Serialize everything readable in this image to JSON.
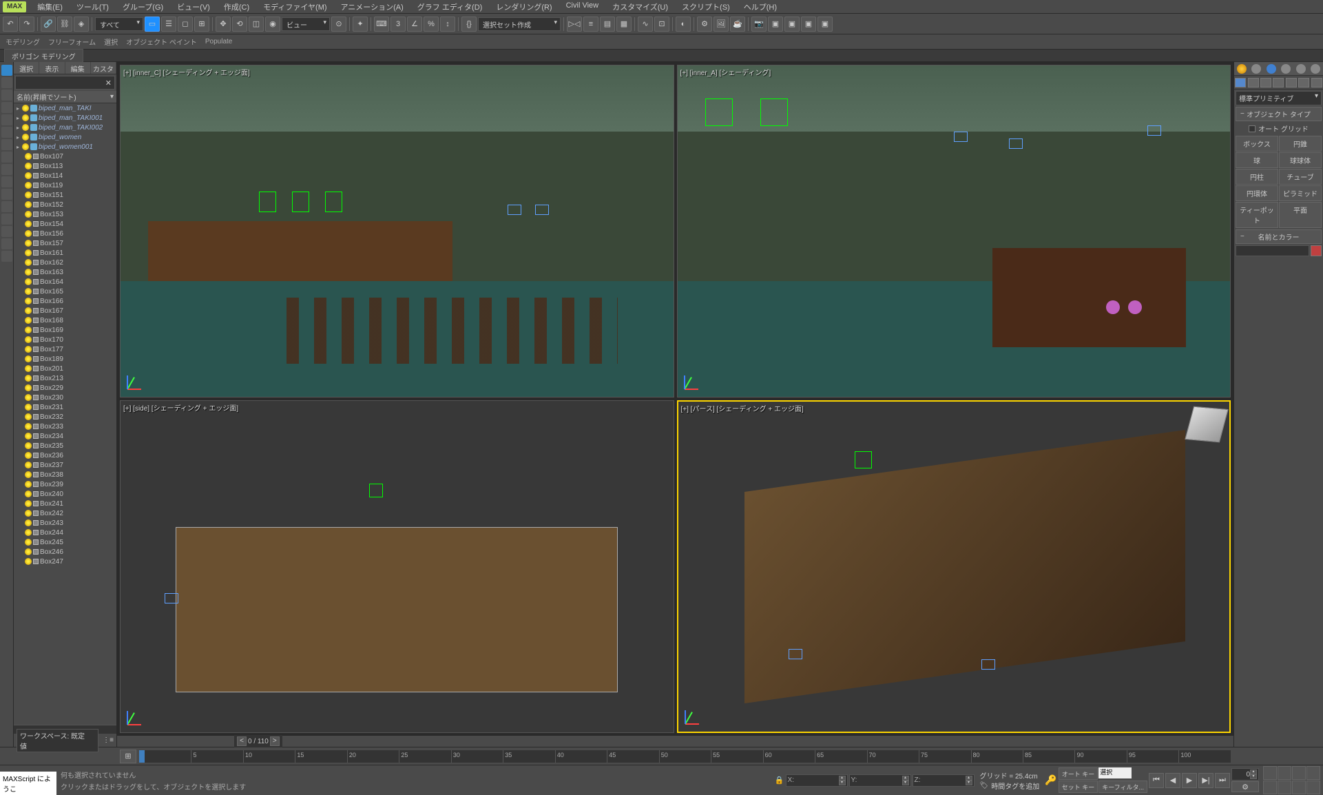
{
  "app": {
    "logo": "MAX"
  },
  "menu": {
    "items": [
      "編集(E)",
      "ツール(T)",
      "グループ(G)",
      "ビュー(V)",
      "作成(C)",
      "モディファイヤ(M)",
      "アニメーション(A)",
      "グラフ エディタ(D)",
      "レンダリング(R)",
      "Civil View",
      "カスタマイズ(U)",
      "スクリプト(S)",
      "ヘルプ(H)"
    ]
  },
  "toolbar1": {
    "filter_dropdown": "すべて",
    "view_dropdown": "ビュー",
    "selection_set_dropdown": "選択セット作成"
  },
  "secondBar": {
    "items": [
      "モデリング",
      "フリーフォーム",
      "選択",
      "オブジェクト ペイント",
      "Populate"
    ]
  },
  "ribbonTab": "ポリゴン モデリング",
  "scenePanel": {
    "tabs": [
      "選択",
      "表示",
      "編集",
      "カスタマイズ"
    ],
    "sortHeader": "名前(昇順でソート)",
    "items": [
      {
        "type": "biped",
        "collapse": "▸",
        "label": "biped_man_TAKI"
      },
      {
        "type": "biped",
        "collapse": "▸",
        "label": "biped_man_TAKI001"
      },
      {
        "type": "biped",
        "collapse": "▸",
        "label": "biped_man_TAKI002"
      },
      {
        "type": "biped",
        "collapse": "▸",
        "label": "biped_women"
      },
      {
        "type": "biped",
        "collapse": "▸",
        "label": "biped_women001"
      },
      {
        "type": "box",
        "label": "Box107"
      },
      {
        "type": "box",
        "label": "Box113"
      },
      {
        "type": "box",
        "label": "Box114"
      },
      {
        "type": "box",
        "label": "Box119"
      },
      {
        "type": "box",
        "label": "Box151"
      },
      {
        "type": "box",
        "label": "Box152"
      },
      {
        "type": "box",
        "label": "Box153"
      },
      {
        "type": "box",
        "label": "Box154"
      },
      {
        "type": "box",
        "label": "Box156"
      },
      {
        "type": "box",
        "label": "Box157"
      },
      {
        "type": "box",
        "label": "Box161"
      },
      {
        "type": "box",
        "label": "Box162"
      },
      {
        "type": "box",
        "label": "Box163"
      },
      {
        "type": "box",
        "label": "Box164"
      },
      {
        "type": "box",
        "label": "Box165"
      },
      {
        "type": "box",
        "label": "Box166"
      },
      {
        "type": "box",
        "label": "Box167"
      },
      {
        "type": "box",
        "label": "Box168"
      },
      {
        "type": "box",
        "label": "Box169"
      },
      {
        "type": "box",
        "label": "Box170"
      },
      {
        "type": "box",
        "label": "Box177"
      },
      {
        "type": "box",
        "label": "Box189"
      },
      {
        "type": "box",
        "label": "Box201"
      },
      {
        "type": "box",
        "label": "Box213"
      },
      {
        "type": "box",
        "label": "Box229"
      },
      {
        "type": "box",
        "label": "Box230"
      },
      {
        "type": "box",
        "label": "Box231"
      },
      {
        "type": "box",
        "label": "Box232"
      },
      {
        "type": "box",
        "label": "Box233"
      },
      {
        "type": "box",
        "label": "Box234"
      },
      {
        "type": "box",
        "label": "Box235"
      },
      {
        "type": "box",
        "label": "Box236"
      },
      {
        "type": "box",
        "label": "Box237"
      },
      {
        "type": "box",
        "label": "Box238"
      },
      {
        "type": "box",
        "label": "Box239"
      },
      {
        "type": "box",
        "label": "Box240"
      },
      {
        "type": "box",
        "label": "Box241"
      },
      {
        "type": "box",
        "label": "Box242"
      },
      {
        "type": "box",
        "label": "Box243"
      },
      {
        "type": "box",
        "label": "Box244"
      },
      {
        "type": "box",
        "label": "Box245"
      },
      {
        "type": "box",
        "label": "Box246"
      },
      {
        "type": "box",
        "label": "Box247"
      }
    ]
  },
  "workspaceBar": {
    "label": "ワークスペース: 既定値"
  },
  "viewports": {
    "tl": "[+] [inner_C] [シェーディング + エッジ面]",
    "tr": "[+] [inner_A] [シェーディング]",
    "bl": "[+] [side] [シェーディング + エッジ面]",
    "br": "[+] [パース] [シェーディング + エッジ面]"
  },
  "rightPanel": {
    "primitiveDropdown": "標準プリミティブ",
    "objectTypeHeader": "オブジェクト タイプ",
    "autoGridLabel": "オート グリッド",
    "buttons": [
      [
        "ボックス",
        "円錐"
      ],
      [
        "球",
        "球球体"
      ],
      [
        "円柱",
        "チューブ"
      ],
      [
        "円環体",
        "ピラミッド"
      ],
      [
        "ティーポット",
        "平面"
      ]
    ],
    "nameColorHeader": "名前とカラー"
  },
  "frameNav": {
    "display": "0 / 110",
    "prev": "<",
    "next": ">"
  },
  "timeline": {
    "ticks": [
      "0",
      "5",
      "10",
      "15",
      "20",
      "25",
      "30",
      "35",
      "40",
      "45",
      "50",
      "55",
      "60",
      "65",
      "70",
      "75",
      "80",
      "85",
      "90",
      "95",
      "100"
    ]
  },
  "status": {
    "scriptLabel": "MAXScript にようこ",
    "selectionInfo": "何も選択されていません",
    "prompt": "クリックまたはドラッグをして、オブジェクトを選択します",
    "coords": {
      "xLabel": "X:",
      "xVal": "",
      "yLabel": "Y:",
      "yVal": "",
      "zLabel": "Z:",
      "zVal": ""
    },
    "gridReadout": "グリッド = 25.4cm",
    "timeTag": "時間タグを追加",
    "autoKey": "オート キー",
    "setKey": "セット キー",
    "autoKeySelect": "選択",
    "keyFilters": "キーフィルタ..."
  }
}
